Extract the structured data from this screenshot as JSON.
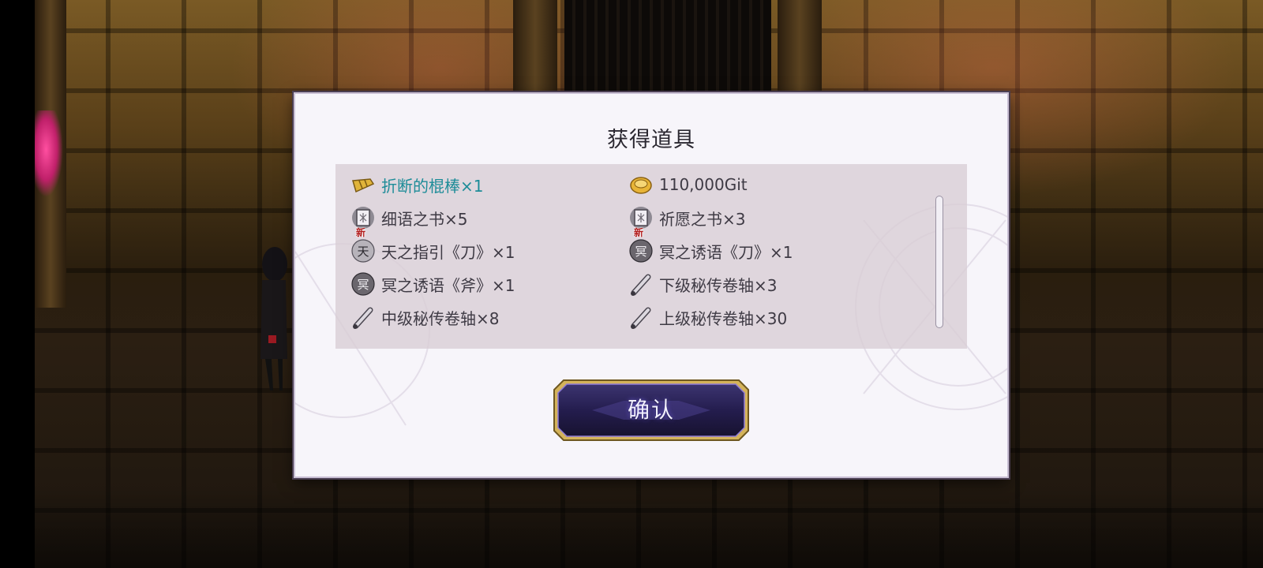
{
  "dialog": {
    "title": "获得道具",
    "confirm_label": "确认"
  },
  "items": [
    {
      "label": "折断的棍棒×1",
      "icon": "broken-club-icon",
      "highlight": true,
      "new": false
    },
    {
      "label": "110,000Git",
      "icon": "gold-coin-icon",
      "highlight": false,
      "new": false
    },
    {
      "label": "细语之书×5",
      "icon": "book-icon",
      "highlight": false,
      "new": false
    },
    {
      "label": "祈愿之书×3",
      "icon": "book-icon",
      "highlight": false,
      "new": false
    },
    {
      "label": "天之指引《刀》×1",
      "icon": "heaven-seal-icon",
      "highlight": false,
      "new": true
    },
    {
      "label": "冥之诱语《刀》×1",
      "icon": "underworld-seal-icon",
      "highlight": false,
      "new": true
    },
    {
      "label": "冥之诱语《斧》×1",
      "icon": "underworld-seal-icon",
      "highlight": false,
      "new": false
    },
    {
      "label": "下级秘传卷轴×3",
      "icon": "scroll-icon",
      "highlight": false,
      "new": false
    },
    {
      "label": "中级秘传卷轴×8",
      "icon": "scroll-icon",
      "highlight": false,
      "new": false
    },
    {
      "label": "上级秘传卷轴×30",
      "icon": "scroll-icon",
      "highlight": false,
      "new": false
    }
  ],
  "new_badge": "新",
  "icon_glyphs": {
    "heaven": "天",
    "underworld": "冥"
  },
  "colors": {
    "highlight_text": "#1d8c98",
    "button_accent": "#d4b35a"
  }
}
